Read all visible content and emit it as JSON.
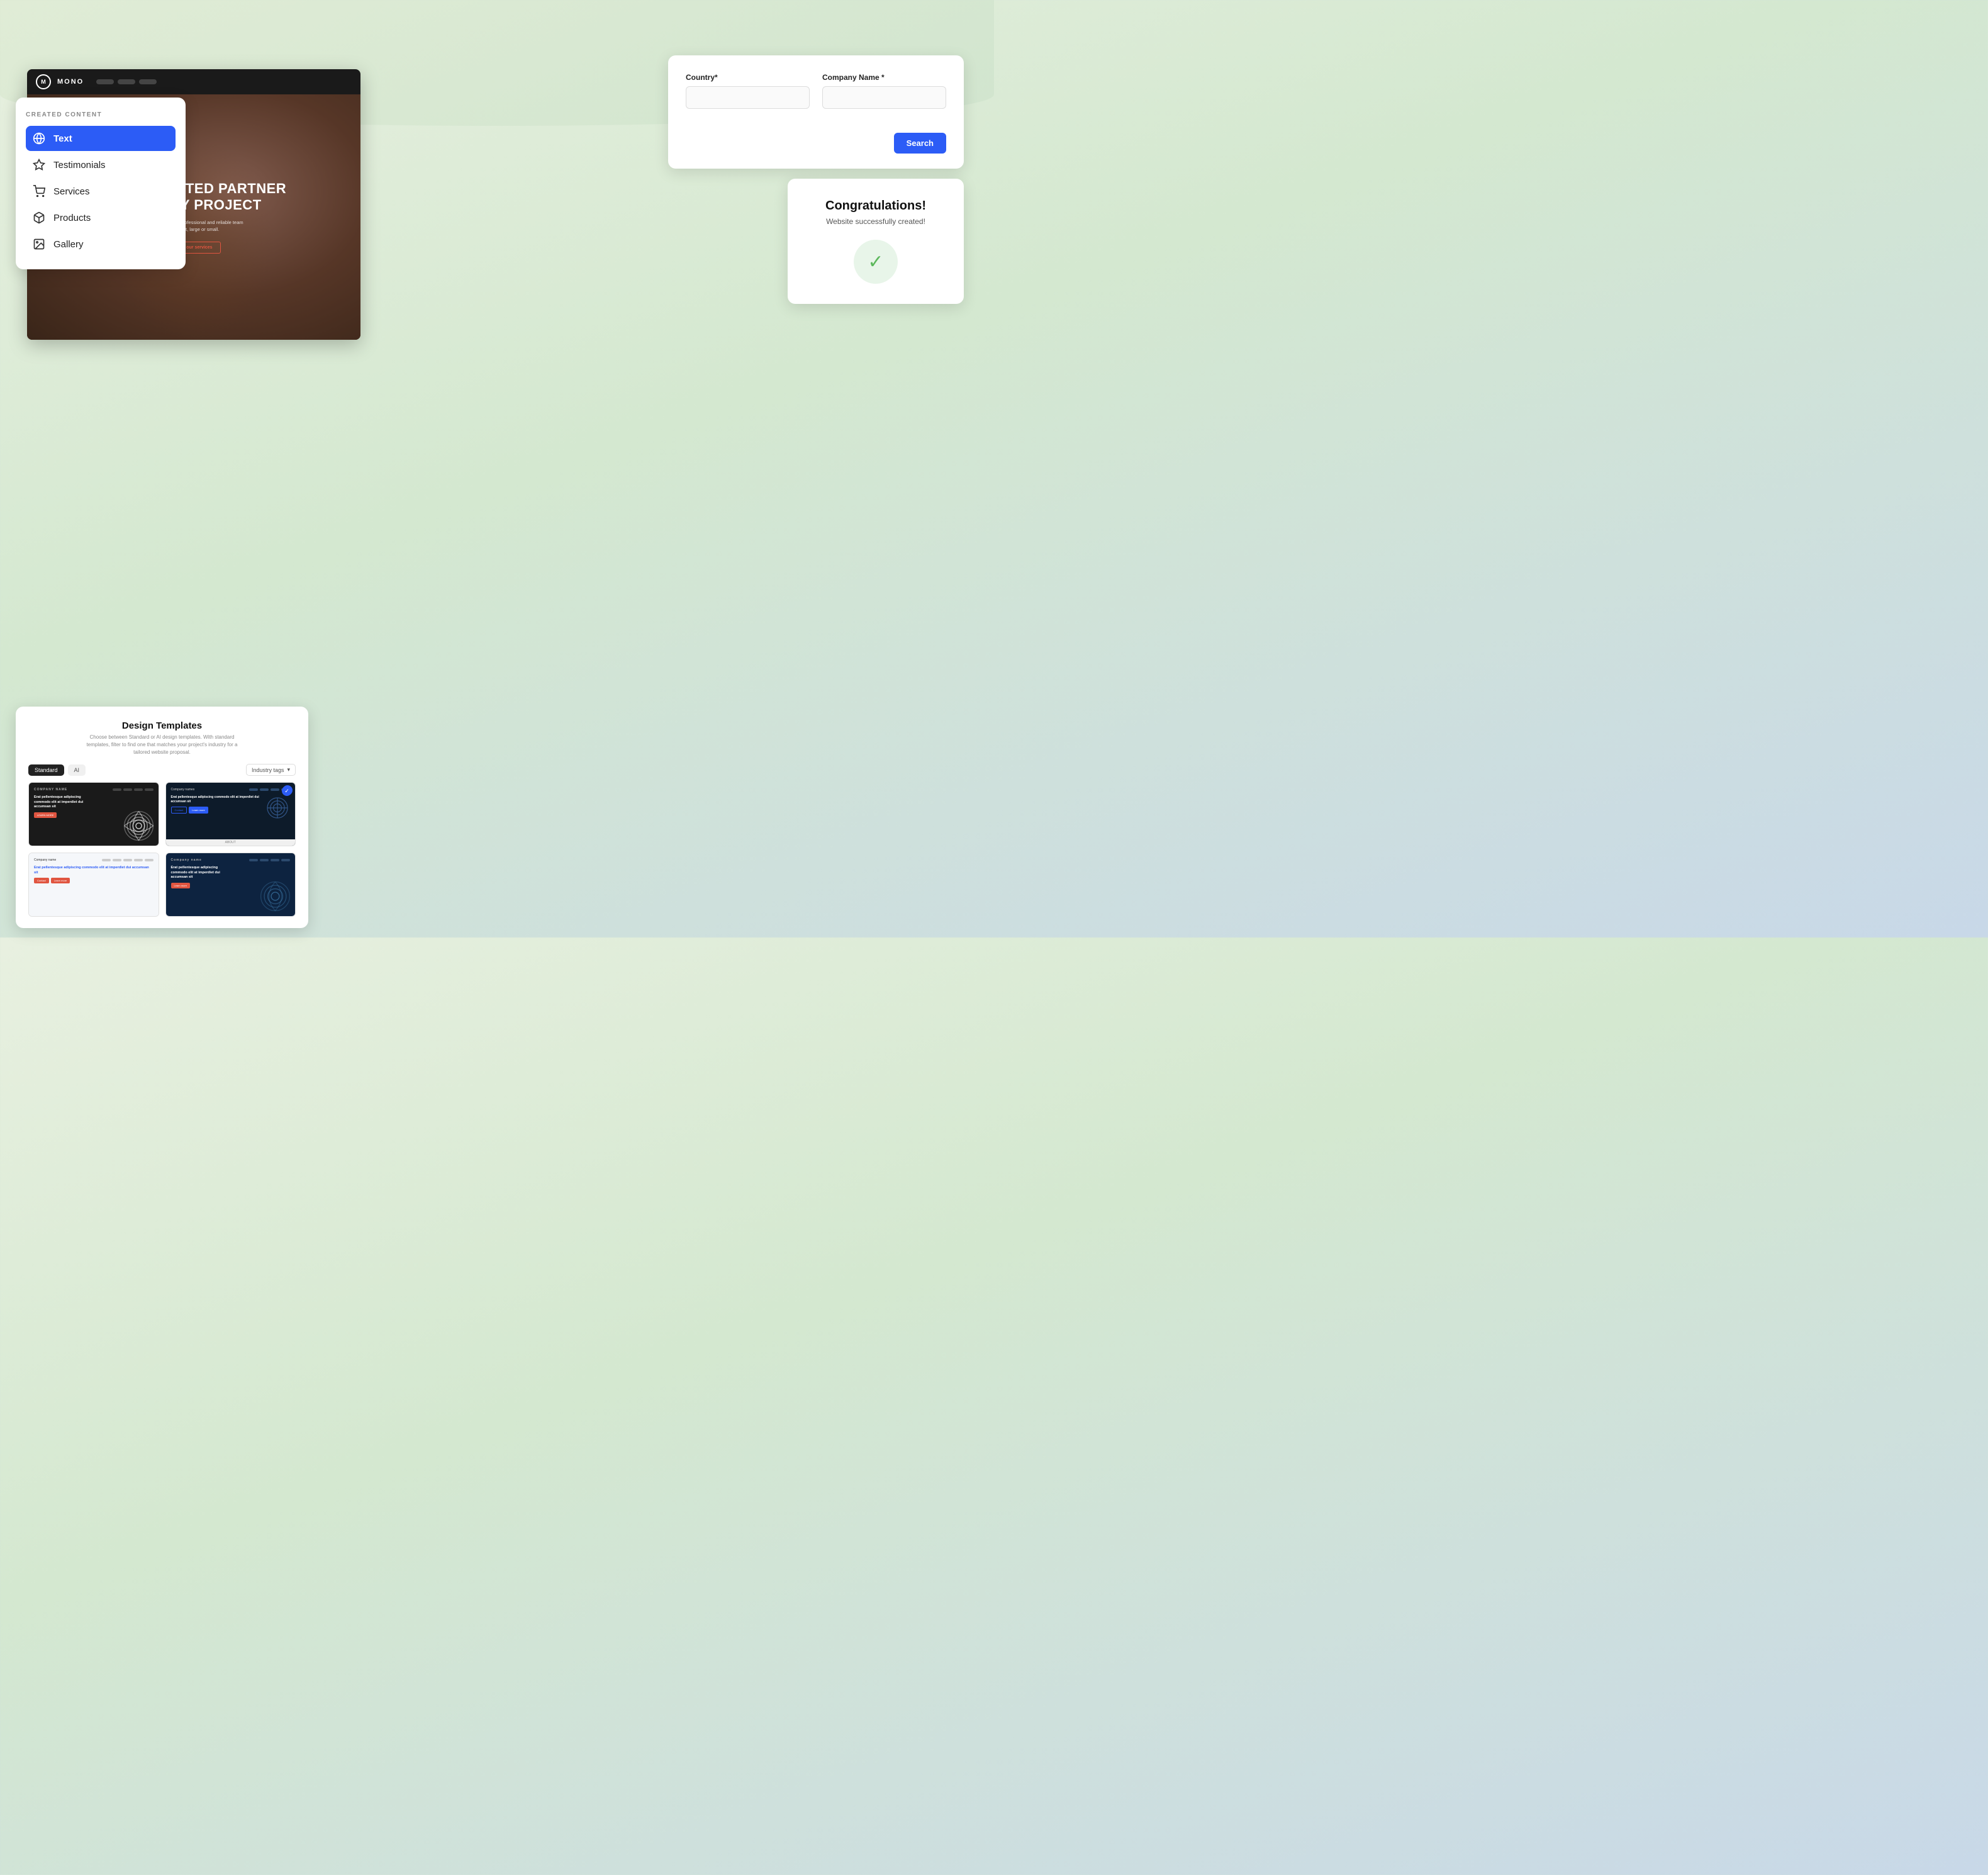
{
  "background": {
    "gradient_start": "#e8f0e0",
    "gradient_end": "#c8d8e8"
  },
  "mono_website": {
    "brand": "MONO",
    "nav_label": "MONO",
    "hero": {
      "title_line1": "YOUR TRUSTED PARTNER",
      "title_line2": "FOR ANY PROJECT",
      "description": "We will get it done with zero hassle! Professional and reliable team able to complete any project, large or small.",
      "cta_label": "View our services"
    }
  },
  "created_content": {
    "section_title": "CREATED CONTENT",
    "items": [
      {
        "id": "text",
        "label": "Text",
        "icon": "globe",
        "active": true
      },
      {
        "id": "testimonials",
        "label": "Testimonials",
        "icon": "star"
      },
      {
        "id": "services",
        "label": "Services",
        "icon": "cart"
      },
      {
        "id": "products",
        "label": "Products",
        "icon": "box"
      },
      {
        "id": "gallery",
        "label": "Gallery",
        "icon": "image"
      }
    ]
  },
  "form_card": {
    "fields": {
      "country": {
        "label": "Country*",
        "placeholder": ""
      },
      "company_name": {
        "label": "Company Name *",
        "placeholder": ""
      }
    },
    "search_button_label": "Search"
  },
  "congrats_card": {
    "title": "Congratulations!",
    "subtitle": "Website successfully created!",
    "check_icon": "✓"
  },
  "design_card": {
    "title": "Design Templates",
    "subtitle": "Choose between Standard or AI design templates. With standard templates, filter to find one that matches your project's industry for a tailored website proposal.",
    "tabs": [
      {
        "label": "Standard",
        "active": true
      },
      {
        "label": "AI",
        "active": false
      }
    ],
    "filter_label": "Industry tags",
    "templates": [
      {
        "id": "dark-spiral",
        "type": "dark",
        "selected": false,
        "text": "Erat pellentesque adipiscing commodo elit at imperdiet dui accumsan sit"
      },
      {
        "id": "dark-blue",
        "type": "blue",
        "selected": true,
        "text": "Erat pellentesque adipiscing commodo elit at imperdiet dui accumsan sit",
        "about_label": "ABOUT"
      },
      {
        "id": "light-blue",
        "type": "light-blue",
        "selected": false,
        "text": "Erat pellentesque adipiscing commodo elit at imperdiet dui accumsan sit"
      },
      {
        "id": "dark-spiral2",
        "type": "dark2",
        "selected": false,
        "text": "Erat pellentesque adipiscing commodo elit at imperdiet dui accumsan sit"
      }
    ]
  }
}
